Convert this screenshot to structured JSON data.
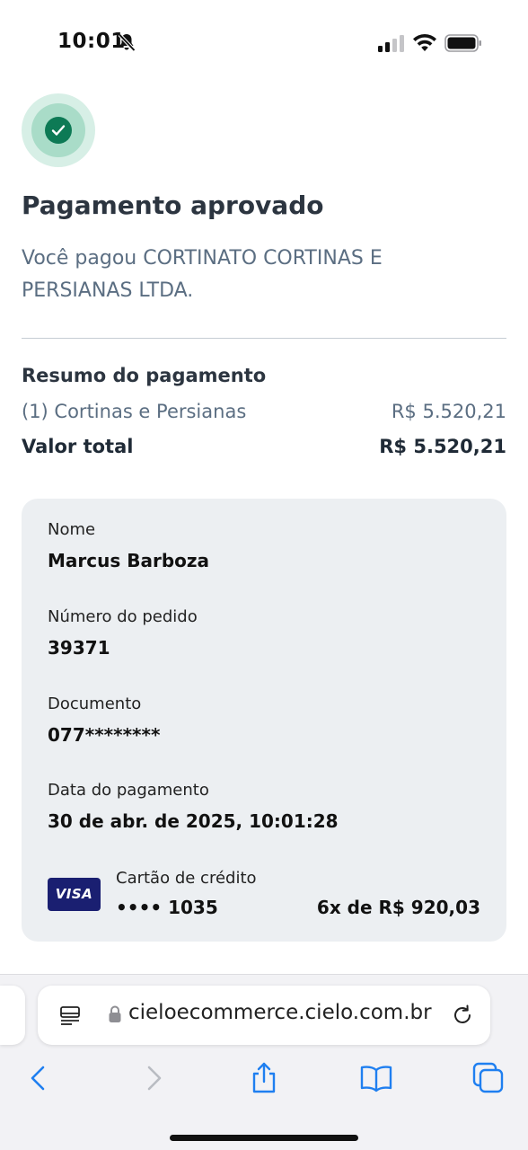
{
  "status_bar": {
    "time": "10:01"
  },
  "payment": {
    "title": "Pagamento aprovado",
    "subtitle": "Você pagou CORTINATO CORTINAS E PERSIANAS LTDA."
  },
  "summary": {
    "title": "Resumo do pagamento",
    "item_label": "(1) Cortinas e Persianas",
    "item_value": "R$ 5.520,21",
    "total_label": "Valor total",
    "total_value": "R$ 5.520,21"
  },
  "details": {
    "name_label": "Nome",
    "name_value": "Marcus Barboza",
    "order_label": "Número do pedido",
    "order_value": "39371",
    "document_label": "Documento",
    "document_value": "077********",
    "date_label": "Data do pagamento",
    "date_value": "30 de abr. de 2025, 10:01:28"
  },
  "card": {
    "brand": "VISA",
    "type": "Cartão de crédito",
    "last_digits": "•••• 1035",
    "installments": "6x de R$ 920,03"
  },
  "browser": {
    "url": "cieloecommerce.cielo.com.br"
  },
  "colors": {
    "success_green": "#0d7a55",
    "card_background": "#eceff2",
    "visa_blue": "#1a1f71",
    "ios_blue": "#1f7ff0"
  },
  "icons": [
    "bell-slash-icon",
    "cellular-signal-icon",
    "wifi-icon",
    "battery-icon",
    "check-icon",
    "reader-icon",
    "lock-icon",
    "reload-icon",
    "back-icon",
    "forward-icon",
    "share-icon",
    "bookmarks-icon",
    "tabs-icon"
  ]
}
